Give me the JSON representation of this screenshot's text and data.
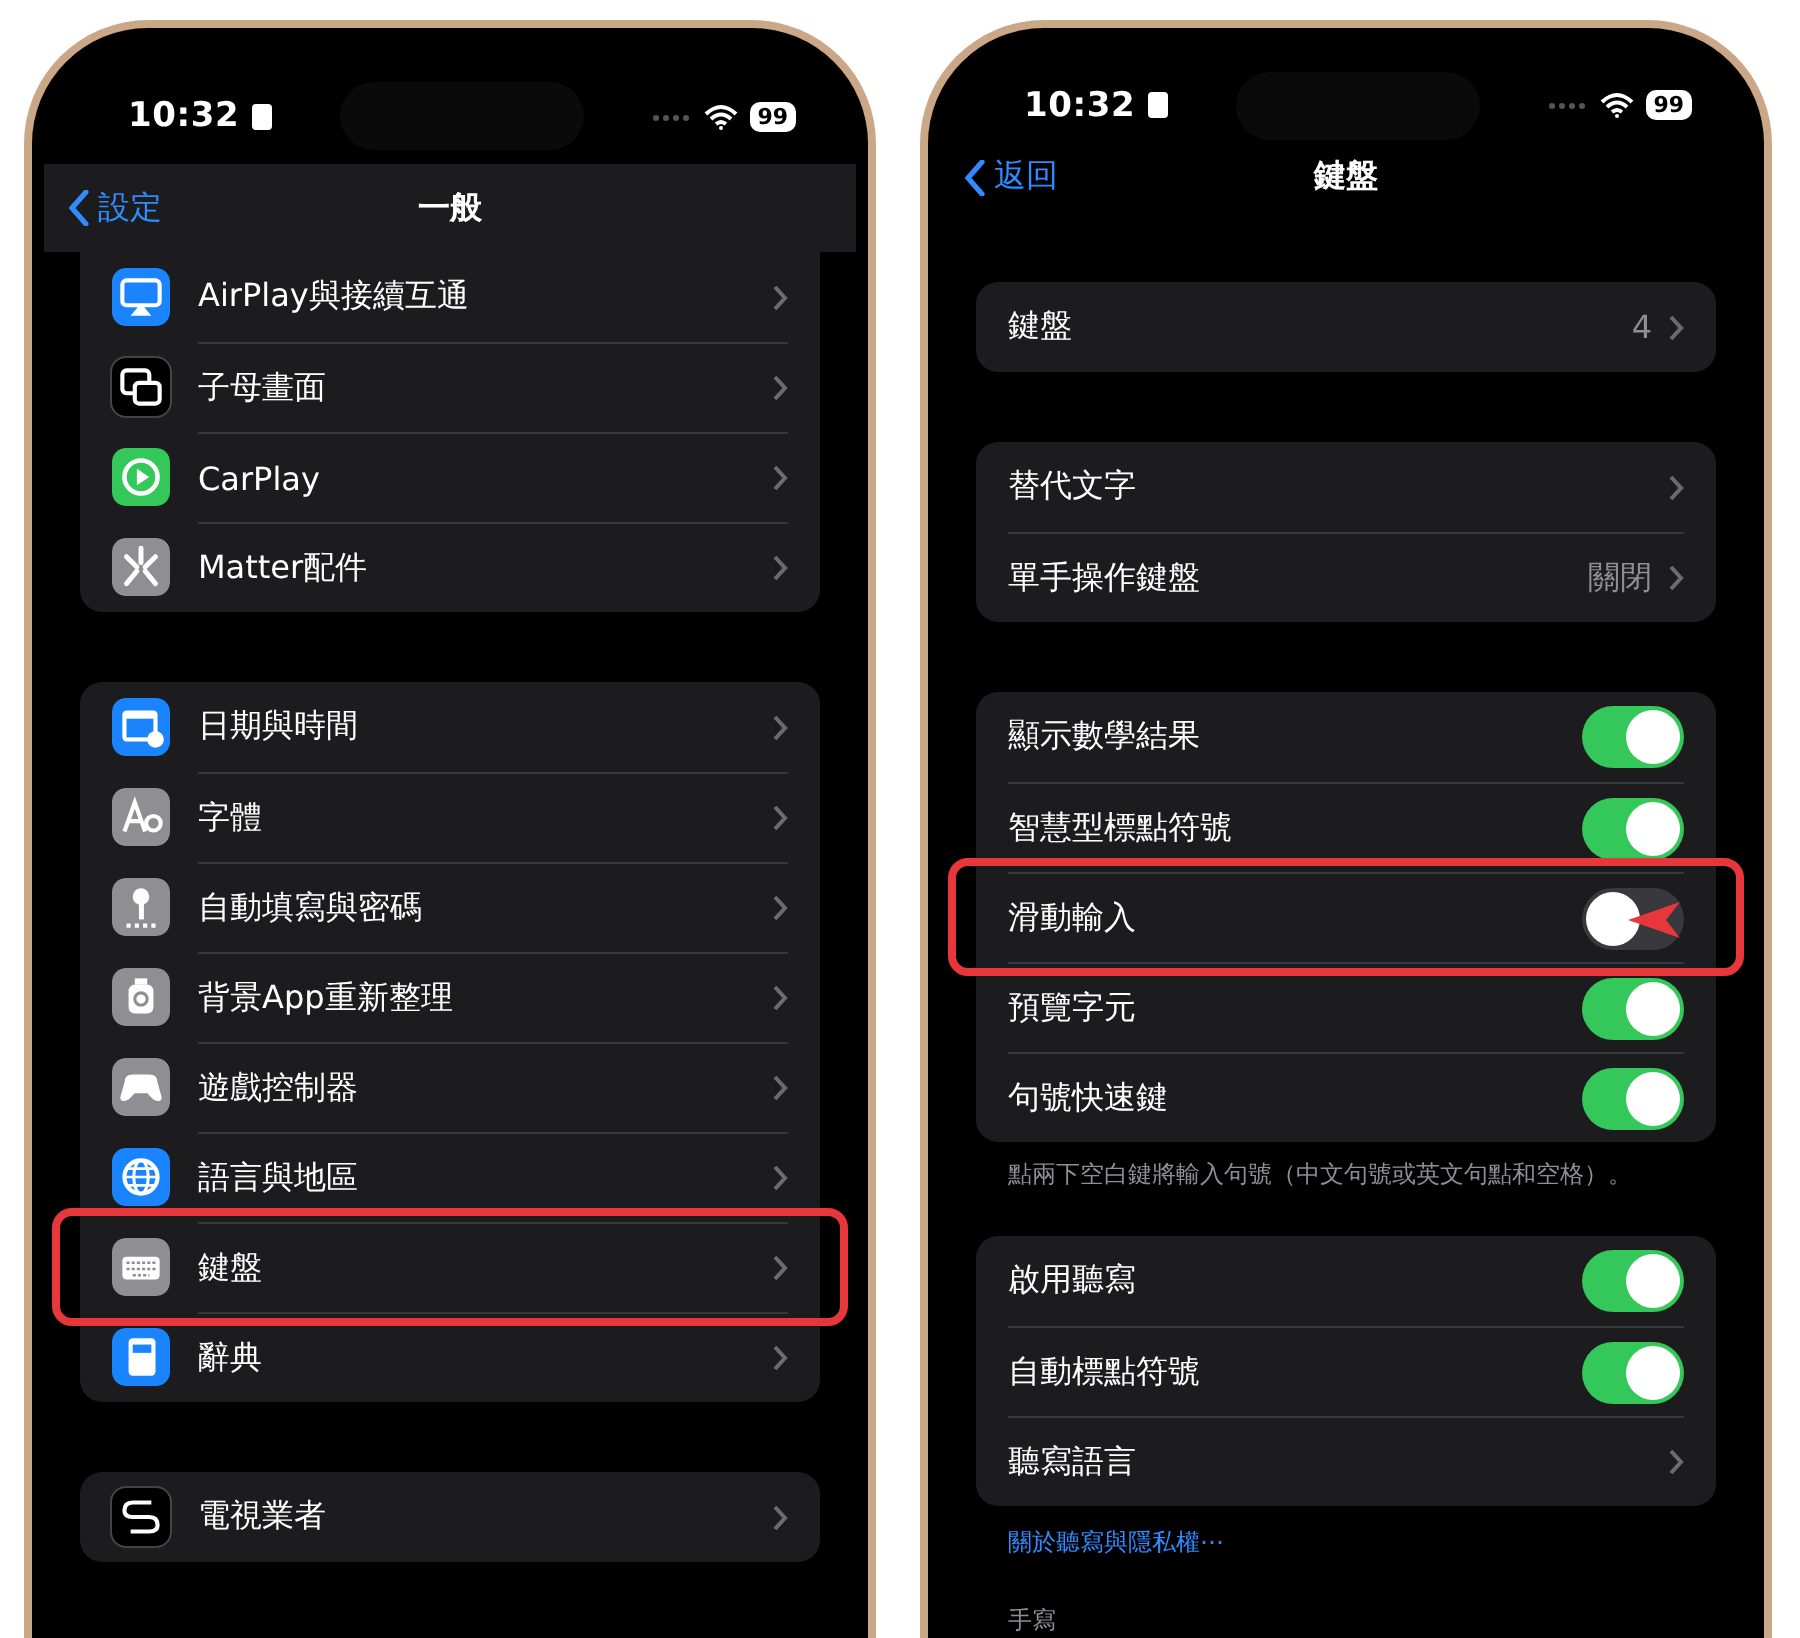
{
  "phones": [
    {
      "status_bar": {
        "time": "10:32",
        "battery": "99"
      },
      "nav": {
        "back": "設定",
        "title": "一般",
        "scrolled": true
      },
      "sections": [
        {
          "rows": [
            {
              "kind": "link",
              "label": "AirPlay與接續互通",
              "color": "#1a84ff",
              "highlighted": false
            },
            {
              "kind": "link",
              "label": "子母畫面",
              "color": "#000000",
              "highlighted": false
            },
            {
              "kind": "link",
              "label": "CarPlay",
              "color": "#34c759",
              "highlighted": false
            },
            {
              "kind": "link",
              "label": "Matter配件",
              "color": "#8e8e93",
              "highlighted": false
            }
          ]
        },
        {
          "rows": [
            {
              "kind": "link",
              "label": "日期與時間",
              "color": "#1a84ff",
              "highlighted": false
            },
            {
              "kind": "link",
              "label": "字體",
              "color": "#8e8e93",
              "highlighted": false
            },
            {
              "kind": "link",
              "label": "自動填寫與密碼",
              "color": "#8e8e93",
              "highlighted": false
            },
            {
              "kind": "link",
              "label": "背景App重新整理",
              "color": "#8e8e93",
              "highlighted": false
            },
            {
              "kind": "link",
              "label": "遊戲控制器",
              "color": "#8e8e93",
              "highlighted": false
            },
            {
              "kind": "link",
              "label": "語言與地區",
              "color": "#1a84ff",
              "highlighted": false
            },
            {
              "kind": "link",
              "label": "鍵盤",
              "color": "#8e8e93",
              "highlighted": true
            },
            {
              "kind": "link",
              "label": "辭典",
              "color": "#1a84ff",
              "highlighted": false
            }
          ]
        },
        {
          "rows": [
            {
              "kind": "link",
              "label": "電視業者",
              "color": "#000000",
              "highlighted": false
            }
          ]
        }
      ]
    },
    {
      "status_bar": {
        "time": "10:32",
        "battery": "99"
      },
      "nav": {
        "back": "返回",
        "title": "鍵盤",
        "scrolled": false
      },
      "sections": [
        {
          "rows": [
            {
              "kind": "value",
              "label": "鍵盤",
              "value": "4",
              "highlighted": false
            }
          ]
        },
        {
          "rows": [
            {
              "kind": "link",
              "label": "替代文字",
              "highlighted": false
            },
            {
              "kind": "value",
              "label": "單手操作鍵盤",
              "value": "關閉",
              "highlighted": false
            }
          ]
        },
        {
          "rows": [
            {
              "kind": "toggle",
              "label": "顯示數學結果",
              "on": true,
              "highlighted": false
            },
            {
              "kind": "toggle",
              "label": "智慧型標點符號",
              "on": true,
              "highlighted": false
            },
            {
              "kind": "toggle",
              "label": "滑動輸入",
              "on": false,
              "highlighted": true
            },
            {
              "kind": "toggle",
              "label": "預覽字元",
              "on": true,
              "highlighted": false
            },
            {
              "kind": "toggle",
              "label": "句號快速鍵",
              "on": true,
              "highlighted": false
            }
          ],
          "footer": "點兩下空白鍵將輸入句號（中文句號或英文句點和空格）。"
        },
        {
          "rows": [
            {
              "kind": "toggle",
              "label": "啟用聽寫",
              "on": true,
              "highlighted": false
            },
            {
              "kind": "toggle",
              "label": "自動標點符號",
              "on": true,
              "highlighted": false
            },
            {
              "kind": "link",
              "label": "聽寫語言",
              "highlighted": false
            }
          ],
          "link": "關於聽寫與隱私權⋯"
        },
        {
          "header": "手寫"
        }
      ]
    }
  ]
}
